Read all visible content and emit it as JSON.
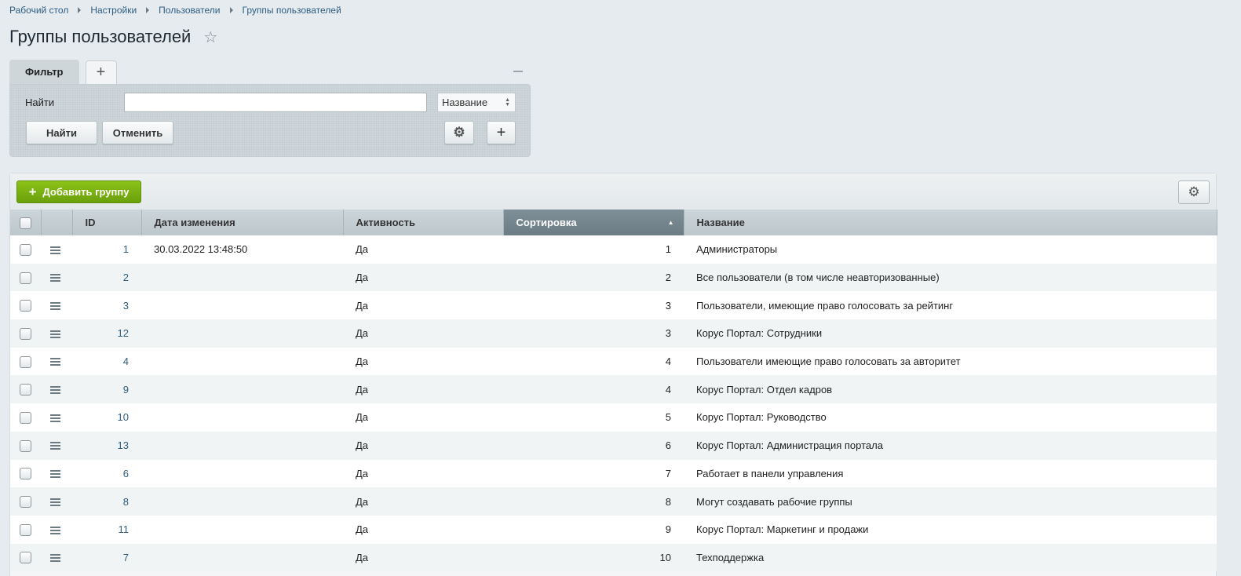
{
  "breadcrumb": [
    "Рабочий стол",
    "Настройки",
    "Пользователи",
    "Группы пользователей"
  ],
  "page": {
    "title": "Группы пользователей"
  },
  "filter": {
    "tab_label": "Фильтр",
    "add_tab_symbol": "+",
    "find_label": "Найти",
    "search_value": "",
    "field_select": "Название",
    "find_button": "Найти",
    "cancel_button": "Отменить"
  },
  "toolbar": {
    "add_label": "Добавить группу"
  },
  "table": {
    "columns": {
      "id": "ID",
      "date": "Дата изменения",
      "active": "Активность",
      "sort": "Сортировка",
      "name": "Название"
    },
    "rows": [
      {
        "id": "1",
        "date": "30.03.2022 13:48:50",
        "active": "Да",
        "sort": "1",
        "name": "Администраторы"
      },
      {
        "id": "2",
        "date": "",
        "active": "Да",
        "sort": "2",
        "name": "Все пользователи (в том числе неавторизованные)"
      },
      {
        "id": "3",
        "date": "",
        "active": "Да",
        "sort": "3",
        "name": "Пользователи, имеющие право голосовать за рейтинг"
      },
      {
        "id": "12",
        "date": "",
        "active": "Да",
        "sort": "3",
        "name": "Корус Портал: Сотрудники"
      },
      {
        "id": "4",
        "date": "",
        "active": "Да",
        "sort": "4",
        "name": "Пользователи имеющие право голосовать за авторитет"
      },
      {
        "id": "9",
        "date": "",
        "active": "Да",
        "sort": "4",
        "name": "Корус Портал: Отдел кадров"
      },
      {
        "id": "10",
        "date": "",
        "active": "Да",
        "sort": "5",
        "name": "Корус Портал: Руководство"
      },
      {
        "id": "13",
        "date": "",
        "active": "Да",
        "sort": "6",
        "name": "Корус Портал: Администрация портала"
      },
      {
        "id": "6",
        "date": "",
        "active": "Да",
        "sort": "7",
        "name": "Работает в панели управления"
      },
      {
        "id": "8",
        "date": "",
        "active": "Да",
        "sort": "8",
        "name": "Могут создавать рабочие группы"
      },
      {
        "id": "11",
        "date": "",
        "active": "Да",
        "sort": "9",
        "name": "Корус Портал: Маркетинг и продажи"
      },
      {
        "id": "7",
        "date": "",
        "active": "Да",
        "sort": "10",
        "name": "Техподдержка"
      }
    ]
  },
  "icons": {
    "favorite": "star-icon",
    "settings": "gear-icon",
    "row_menu": "menu-icon",
    "add": "plus-icon",
    "collapse": "minus-icon"
  }
}
